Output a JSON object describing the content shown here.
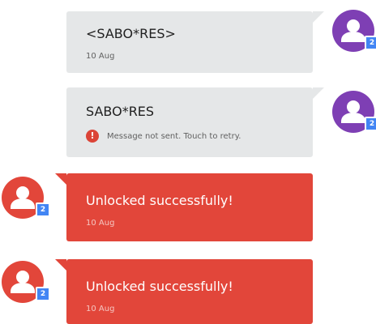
{
  "conversation": {
    "messages": [
      {
        "direction": "outgoing",
        "text": "<SABO*RES>",
        "date": "10 Aug",
        "avatar_color": "#7e3fb4",
        "badge": "2"
      },
      {
        "direction": "outgoing",
        "text": "SABO*RES",
        "error": "Message not sent. Touch to retry.",
        "error_icon": "error-icon",
        "avatar_color": "#7e3fb4",
        "badge": "2"
      },
      {
        "direction": "incoming",
        "text": "Unlocked successfully!",
        "date": "10 Aug",
        "avatar_color": "#e2463a",
        "badge": "2"
      },
      {
        "direction": "incoming",
        "text": "Unlocked successfully!",
        "date": "10 Aug",
        "avatar_color": "#e2463a",
        "badge": "2"
      }
    ]
  },
  "colors": {
    "outgoing_bubble": "#e5e7e8",
    "incoming_bubble": "#e2463a",
    "badge": "#4285f4",
    "error": "#db4437"
  }
}
